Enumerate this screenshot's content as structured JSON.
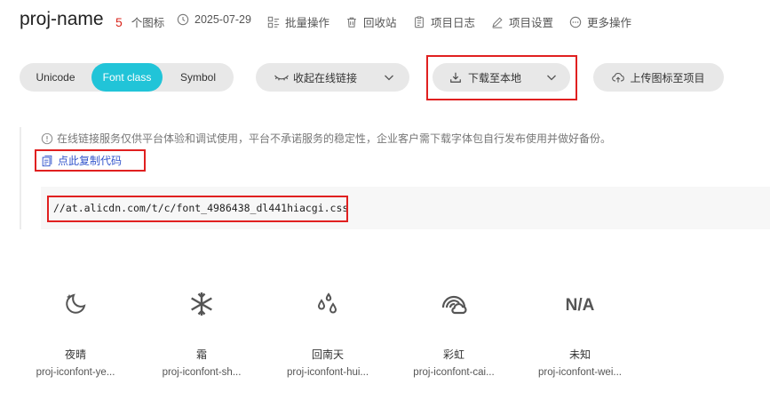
{
  "header": {
    "project_name": "proj-name",
    "icon_count": "5",
    "icon_count_label": "个图标",
    "date": "2025-07-29",
    "actions": [
      {
        "label": "批量操作",
        "icon": "batch-icon"
      },
      {
        "label": "回收站",
        "icon": "trash-icon"
      },
      {
        "label": "项目日志",
        "icon": "log-icon"
      },
      {
        "label": "项目设置",
        "icon": "settings-icon"
      },
      {
        "label": "更多操作",
        "icon": "more-icon"
      }
    ]
  },
  "toolbar": {
    "tabs": [
      "Unicode",
      "Font class",
      "Symbol"
    ],
    "active_tab": "Font class",
    "online_link_label": "收起在线链接",
    "download_label": "下载至本地",
    "upload_label": "上传图标至项目",
    "accent_color": "#21c4d8",
    "highlight_color": "#e02020"
  },
  "notice": {
    "text": "在线链接服务仅供平台体验和调试使用，平台不承诺服务的稳定性，企业客户需下载字体包自行发布使用并做好备份。",
    "copy_label": "点此复制代码",
    "css_url": "//at.alicdn.com/t/c/font_4986438_dl441hiacgi.css"
  },
  "icons": [
    {
      "name": "夜晴",
      "class": "proj-iconfont-ye...",
      "icon": "moon-night-icon"
    },
    {
      "name": "霜",
      "class": "proj-iconfont-sh...",
      "icon": "snowflake-icon"
    },
    {
      "name": "回南天",
      "class": "proj-iconfont-hui...",
      "icon": "droplets-icon"
    },
    {
      "name": "彩虹",
      "class": "proj-iconfont-cai...",
      "icon": "rainbow-icon"
    },
    {
      "name": "未知",
      "class": "proj-iconfont-wei...",
      "icon": "na-icon"
    }
  ]
}
